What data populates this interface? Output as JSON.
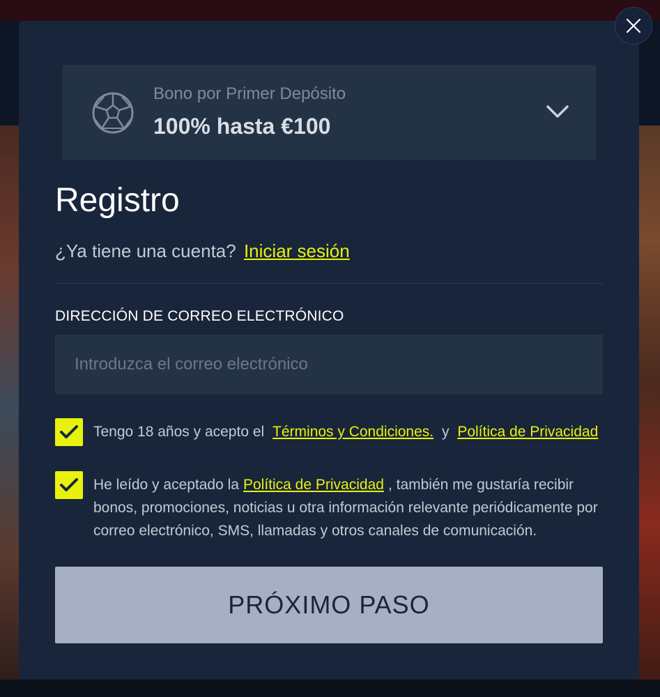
{
  "bonus": {
    "subtitle": "Bono por Primer Depósito",
    "title": "100% hasta €100",
    "icon": "soccer-ball-icon"
  },
  "form": {
    "title": "Registro",
    "login_prompt": "¿Ya tiene una cuenta?",
    "login_link": "Iniciar sesión",
    "email_label": "DIRECCIÓN DE CORREO ELECTRÓNICO",
    "email_placeholder": "Introduzca el correo electrónico",
    "email_value": "",
    "consent_terms": {
      "checked": true,
      "text_before": "Tengo 18 años y acepto el",
      "terms_link": "Términos y Condiciones.",
      "joiner": "y",
      "privacy_link": "Política de Privacidad"
    },
    "consent_marketing": {
      "checked": true,
      "text_before": "He leído y aceptado la",
      "privacy_link": "Política de Privacidad",
      "text_after": ", también me gustaría recibir bonos, promociones, noticias u otra información relevante periódicamente por correo electrónico, SMS, llamadas y otros canales de comunicación."
    },
    "next_button": "PRÓXIMO PASO"
  },
  "colors": {
    "accent": "#e8f20c",
    "modal_bg": "#19253a",
    "card_bg": "#243246",
    "button_bg": "#a7b0c2"
  }
}
